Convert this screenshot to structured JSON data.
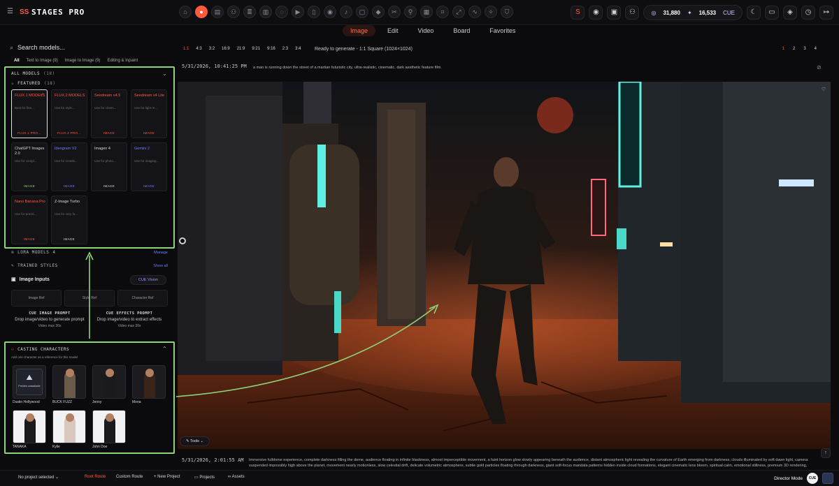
{
  "app": {
    "brand": "STAGES PRO"
  },
  "topbar": {
    "tool_icons": [
      "home-icon",
      "active-tool-icon",
      "layers-icon",
      "users-icon",
      "stack-icon",
      "film-icon",
      "chat-icon",
      "video-icon",
      "phone-icon",
      "eye-icon",
      "music-icon",
      "box-icon",
      "cube-icon",
      "scissors-icon",
      "pin-icon",
      "archive-icon",
      "frame-icon",
      "expand-icon",
      "pulse-icon",
      "bulb-icon",
      "shield-icon"
    ],
    "credits_a": "31,880",
    "credits_b": "16,533",
    "credits_unit": "CUE"
  },
  "mode_tabs": [
    "Image",
    "Edit",
    "Video",
    "Board",
    "Favorites"
  ],
  "active_mode": "Image",
  "left": {
    "search_placeholder": "Search models...",
    "filters": [
      {
        "label": "All",
        "count": ""
      },
      {
        "label": "Text to Image",
        "count": "(9)"
      },
      {
        "label": "Image to Image",
        "count": "(9)"
      },
      {
        "label": "Editing & Inpaint",
        "count": ""
      }
    ],
    "all_models_label": "ALL MODELS",
    "all_models_count": "(18)",
    "featured_label": "FEATURED",
    "featured_count": "(18)",
    "models": [
      {
        "name": "FLUX.1 MODELS",
        "desc": "Best for fine...",
        "tag": "FLUX.1 PRO...",
        "style": "o"
      },
      {
        "name": "FLUX.2 MODELS",
        "desc": "Use for style...",
        "tag": "FLUX.2 PRO...",
        "style": "o"
      },
      {
        "name": "Seedream v4.5",
        "desc": "Use for cinem...",
        "tag": "IMAGE",
        "style": "o"
      },
      {
        "name": "Seedream v4 Lite",
        "desc": "Use for light re...",
        "tag": "IMAGE",
        "style": "o"
      },
      {
        "name": "ChatGPT Images 2.0",
        "desc": "Use for compl...",
        "tag": "IMAGE",
        "style": "g"
      },
      {
        "name": "Ideogram V2",
        "desc": "Use for creativ...",
        "tag": "IMAGE",
        "style": "b"
      },
      {
        "name": "Imagen 4",
        "desc": "Use for photo...",
        "tag": "IMAGE",
        "style": "w"
      },
      {
        "name": "Gemini 2",
        "desc": "Use for imaging...",
        "tag": "IMAGE",
        "style": "b"
      },
      {
        "name": "Nano Banana Pro",
        "desc": "Use for precis...",
        "tag": "IMAGE",
        "style": "o"
      },
      {
        "name": "Z-Image Turbo",
        "desc": "Use for very fa...",
        "tag": "IMAGE",
        "style": "w"
      }
    ],
    "lora_label": "LORA MODELS",
    "lora_count": "4",
    "lora_link": "Manage",
    "trained_label": "TRAINED STYLES",
    "trained_link": "Show all",
    "image_inputs": "Image Inputs",
    "cue_vision": "CUE Vision",
    "refs": [
      "Image Ref",
      "Style Ref",
      "Character Ref"
    ],
    "drop_prompt": {
      "title": "CUE IMAGE PROMPT",
      "desc": "Drop image/video to generate prompt",
      "max": "Video max 30s"
    },
    "drop_effects": {
      "title": "CUE EFFECTS PROMPT",
      "desc": "Drop image/video to extract effects",
      "max": "Video max 30s"
    },
    "casting_label": "CASTING CHARACTERS",
    "casting_hint": "Add one character as a reference for this model",
    "preview_text": "Preview unavailable",
    "characters": [
      "Dustin Hollywood",
      "BUCK FUZZ",
      "Jenny",
      "Mona",
      "TANAKA",
      "Kylie",
      "John Doe"
    ]
  },
  "generate": {
    "ratios": [
      "1:1",
      "4:3",
      "3:2",
      "16:9",
      "21:9",
      "9:21",
      "9:16",
      "2:3",
      "3:4"
    ],
    "active_ratio": "1:1",
    "status": "Ready to generate - 1:1 Square (1024×1024)",
    "pages": [
      "1",
      "2",
      "3",
      "4"
    ],
    "active_page": "1"
  },
  "result1": {
    "timestamp": "5/31/2026, 10:41:25 PM",
    "prompt": "a man is running down the street of a martian futuristic city, ultra-realistic, cinematic, dark aesthetic feature film."
  },
  "tools_label": "Tools",
  "result2": {
    "timestamp": "5/31/2026, 2:01:55 AM",
    "prompt": "Immersive fulldome experience, complete darkness filling the dome, audience floating in infinite blackness, almost imperceptible movement, a faint horizon glow slowly appearing beneath the audience, distant atmospheric light revealing the curvature of Earth emerging from darkness, clouds illuminated by soft dawn light, camera suspended impossibly high above the planet, movement nearly motionless, slow celestial drift, delicate volumetric atmosphere, subtle gold particles floating through darkness, giant soft-focus mandala patterns hidden inside cloud formations, elegant cinematic lens bloom, spiritual calm, emotional stillness, premium 3D rendering, atmospheric depth extending infinitely, no hard contrast, no rapid motion, no spectacle, only wonder. Earth breathing slowly beneath the audience, gentle synchronized to narration cadence, immersive dome composition, highly detailed atmosphere, soft blue, gold and white palette, dreamlike realism, transcendent beauty, WORLDS aesthetic, Astronomica inspiration, sacred quietness, in the style of ultra-realis"
  },
  "bottombar": {
    "project": "No project selected",
    "root_route": "Root Route",
    "custom_route": "Custom Route",
    "new_project": "New Project",
    "projects": "Projects",
    "assets": "Assets",
    "director": "Director Mode",
    "cue": "CUE"
  },
  "colors": {
    "accent": "#ff5a3c",
    "annotation": "#8fd47a",
    "link": "#6a7dff"
  }
}
